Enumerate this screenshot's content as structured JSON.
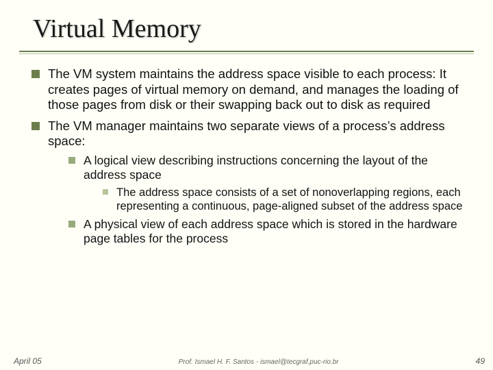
{
  "title": "Virtual Memory",
  "bullets": {
    "l1a": "The VM system maintains the address space visible to each process:  It creates pages of virtual memory on demand, and manages the loading of those pages from disk or their swapping back out to disk as required",
    "l1b": "The VM manager maintains two separate views of a process’s address space:",
    "l2a": "A logical view describing instructions concerning the layout of the address space",
    "l3a": "The address space consists of a set of nonoverlapping regions, each representing a continuous, page-aligned subset of the address space",
    "l2b": "A physical view of each address space which is stored in the hardware page tables for the process"
  },
  "footer": {
    "date": "April 05",
    "center": "Prof. Ismael H. F. Santos - ismael@tecgraf.puc-rio.br",
    "page": "49"
  }
}
